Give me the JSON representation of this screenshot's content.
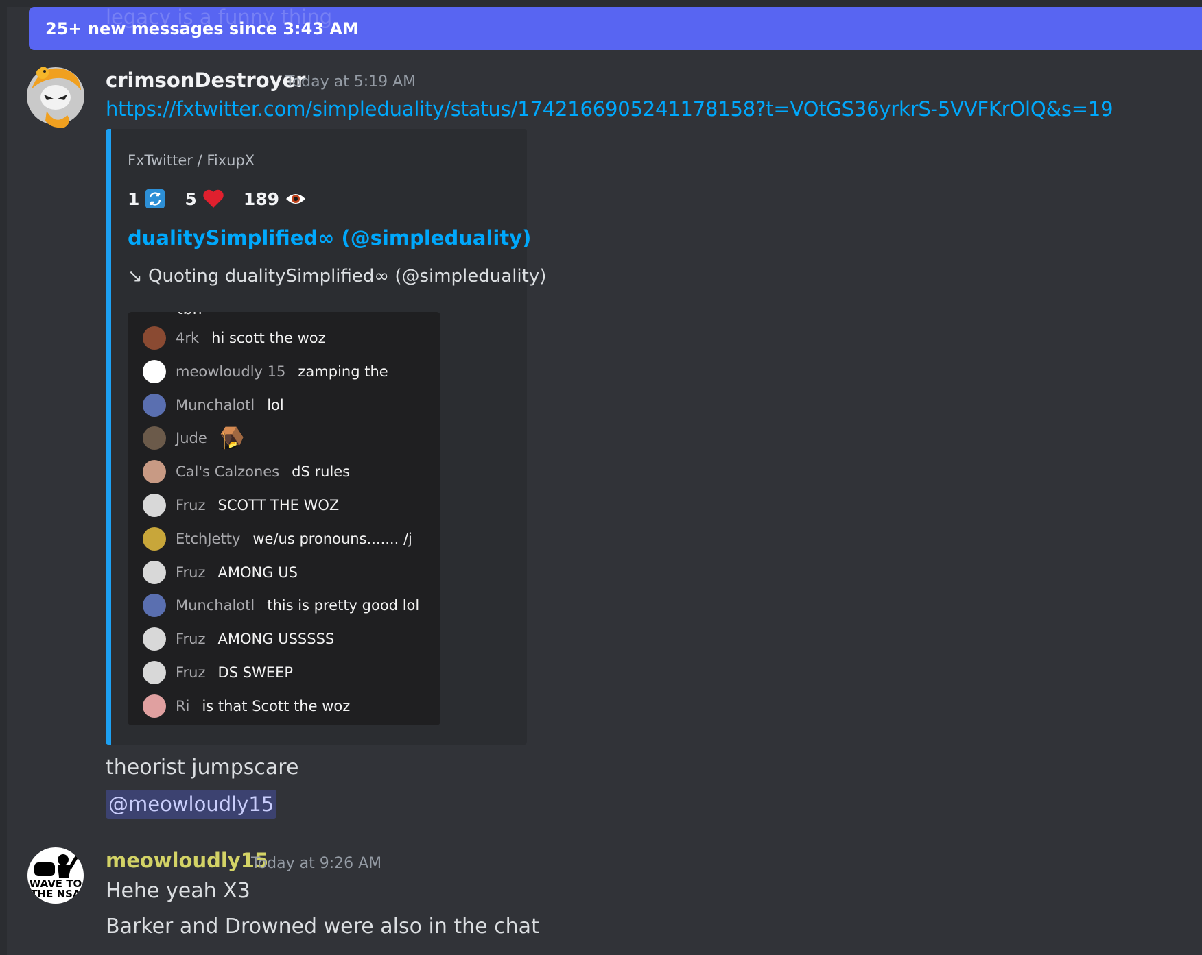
{
  "banner": {
    "text": "25+ new messages since 3:43 AM",
    "partial_previous_text": "legacy is a funny thing"
  },
  "messages": [
    {
      "username": "crimsonDestroyer",
      "username_color": "#f2f3f5",
      "timestamp": "Today at 5:19 AM",
      "link": "https://fxtwitter.com/simpleduality/status/1742166905241178158?t=VOtGS36yrkrS-5VVFKrOlQ&s=19",
      "embed": {
        "provider": "FxTwitter / FixupX",
        "stats": {
          "retweets": "1",
          "likes": "5",
          "views": "189"
        },
        "author": "dualitySimplified∞ (@simpleduality)",
        "quote": "↘ Quoting dualitySimplified∞ (@simpleduality)",
        "image_chat": {
          "partial_top": "tbh",
          "rows": [
            {
              "name": "4rk",
              "text": "hi scott the woz",
              "avatar": "#8a4a32"
            },
            {
              "name": "meowloudly 15",
              "text": "zamping the",
              "avatar": "#ffffff"
            },
            {
              "name": "Munchalotl",
              "text": "lol",
              "avatar": "#5a6fb0"
            },
            {
              "name": "Jude",
              "text": "",
              "emoji": "🪤",
              "avatar": "#6b5a4a"
            },
            {
              "name": "Cal's Calzones",
              "text": "dS rules",
              "avatar": "#c89a84"
            },
            {
              "name": "Fruz",
              "text": "SCOTT THE WOZ",
              "avatar": "#d8d8d8"
            },
            {
              "name": "EtchJetty",
              "text": "we/us pronouns....... /j",
              "avatar": "#c8a63a"
            },
            {
              "name": "Fruz",
              "text": "AMONG US",
              "avatar": "#d8d8d8"
            },
            {
              "name": "Munchalotl",
              "text": "this is pretty good lol",
              "avatar": "#5a6fb0"
            },
            {
              "name": "Fruz",
              "text": "AMONG USSSSS",
              "avatar": "#d8d8d8"
            },
            {
              "name": "Fruz",
              "text": "DS SWEEP",
              "avatar": "#d8d8d8"
            },
            {
              "name": "Ri",
              "text": "is that Scott the woz",
              "avatar": "#e0a0a0"
            }
          ]
        }
      },
      "text": "theorist jumpscare",
      "mention": "@meowloudly15"
    },
    {
      "username": "meowloudly15",
      "username_color": "#d3d366",
      "timestamp": "Today at 9:26 AM",
      "avatar_text": "WAVE TO THE NSA",
      "lines": [
        "Hehe yeah X3",
        "Barker and Drowned were also in the chat"
      ]
    }
  ],
  "colors": {
    "background": "#313338",
    "banner": "#5865f2",
    "link": "#00a8fc",
    "embed_border": "#1da0f2",
    "mention_bg": "#3c4270"
  }
}
